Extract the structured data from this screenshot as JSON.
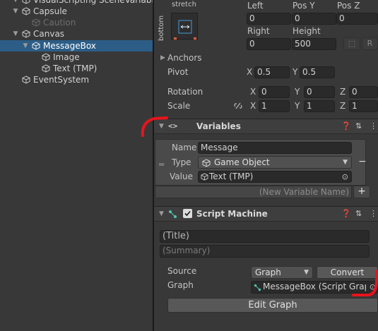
{
  "hierarchy": {
    "items": [
      {
        "label": "VisualScripting SceneVariables"
      },
      {
        "label": "Capsule"
      },
      {
        "label": "Caution"
      },
      {
        "label": "Canvas"
      },
      {
        "label": "MessageBox"
      },
      {
        "label": "Image"
      },
      {
        "label": "Text (TMP)"
      },
      {
        "label": "EventSystem"
      }
    ]
  },
  "rect_transform": {
    "anchor_preset_top": "stretch",
    "anchor_preset_side": "bottom",
    "left_label": "Left",
    "left": "0",
    "posy_label": "Pos Y",
    "posy": "0",
    "posz_label": "Pos Z",
    "posz": "0",
    "right_label": "Right",
    "right": "0",
    "height_label": "Height",
    "height": "500",
    "r_button": "R",
    "anchors_label": "Anchors",
    "pivot_label": "Pivot",
    "pivot_x_label": "X",
    "pivot_x": "0.5",
    "pivot_y_label": "Y",
    "pivot_y": "0.5",
    "rotation_label": "Rotation",
    "rot_x_label": "X",
    "rot_x": "0",
    "rot_y_label": "Y",
    "rot_y": "0",
    "rot_z_label": "Z",
    "rot_z": "0",
    "scale_label": "Scale",
    "scale_x_label": "X",
    "scale_x": "1",
    "scale_y_label": "Y",
    "scale_y": "1",
    "scale_z_label": "Z",
    "scale_z": "1"
  },
  "variables": {
    "header_icon": "<>",
    "title": "Variables",
    "name_label": "Name",
    "name_value": "Message",
    "type_label": "Type",
    "type_value": "Game Object",
    "value_label": "Value",
    "value_value": "Text (TMP)",
    "remove_button": "−",
    "new_variable_placeholder": "(New Variable Name)",
    "add_button": "+"
  },
  "script_machine": {
    "title": "Script Machine",
    "title_placeholder": "(Title)",
    "summary_placeholder": "(Summary)",
    "source_label": "Source",
    "source_value": "Graph",
    "convert_button": "Convert",
    "graph_label": "Graph",
    "graph_value": "MessageBox (Script Graph)",
    "edit_graph_button": "Edit Graph"
  },
  "colors": {
    "selection": "#2c5d87",
    "annotation": "#e8141c"
  }
}
